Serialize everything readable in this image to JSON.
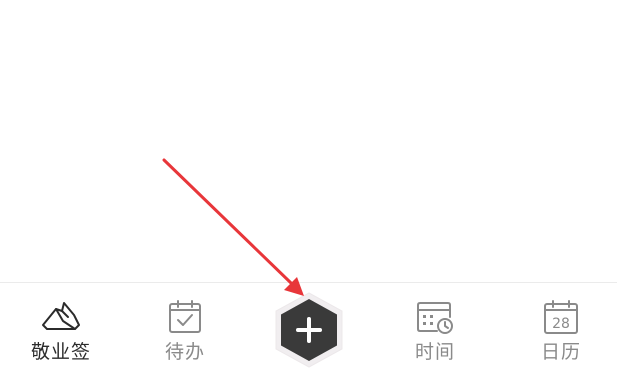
{
  "tab_bar": {
    "tabs": [
      {
        "label": "敬业签",
        "icon": "paper-stack-icon",
        "active": true
      },
      {
        "label": "待办",
        "icon": "calendar-check-icon",
        "active": false
      },
      {
        "label": "时间",
        "icon": "calendar-clock-icon",
        "active": false
      },
      {
        "label": "日历",
        "icon": "calendar-date-icon",
        "active": false
      }
    ],
    "fab": {
      "icon": "plus-icon"
    },
    "calendar_date": "28"
  },
  "annotation": {
    "icon": "red-arrow-icon",
    "color": "#e8363a"
  },
  "colors": {
    "active": "#2b2b2b",
    "inactive": "#8a8a8a",
    "fab_fill": "#3a3a3a",
    "fab_halo": "#f1eef0"
  }
}
